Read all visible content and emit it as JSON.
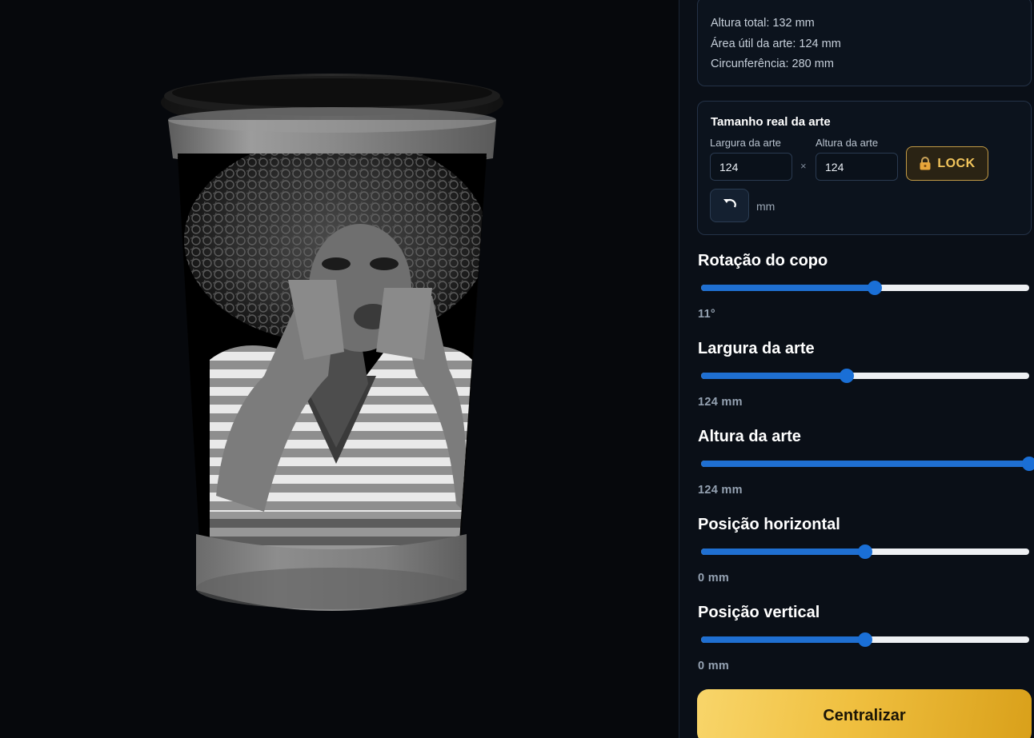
{
  "info": {
    "altura_total": "Altura total: 132 mm",
    "area_util": "Área útil da arte: 124 mm",
    "circunferencia": "Circunferência: 280 mm"
  },
  "size_card": {
    "title": "Tamanho real da arte",
    "width_label": "Largura da arte",
    "height_label": "Altura da arte",
    "width_value": "124",
    "height_value": "124",
    "times": "×",
    "lock_label": "LOCK",
    "lock_icon": "lock-icon",
    "reset_icon": "undo-icon",
    "unit": "mm"
  },
  "controls": [
    {
      "title": "Rotação do copo",
      "value": "11°",
      "level": 0.53
    },
    {
      "title": "Largura da arte",
      "value": "124 mm",
      "level": 0.445
    },
    {
      "title": "Altura da arte",
      "value": "124 mm",
      "level": 1.0
    },
    {
      "title": "Posição horizontal",
      "value": "0 mm",
      "level": 0.5
    },
    {
      "title": "Posição vertical",
      "value": "0 mm",
      "level": 0.5
    }
  ],
  "center_button": "Centralizar",
  "colors": {
    "background": "#06080c",
    "panel": "#0a0f17",
    "accent_blue": "#1f6fd1",
    "lock_gold": "#f2c55c",
    "button_gold": "#f0c040"
  }
}
